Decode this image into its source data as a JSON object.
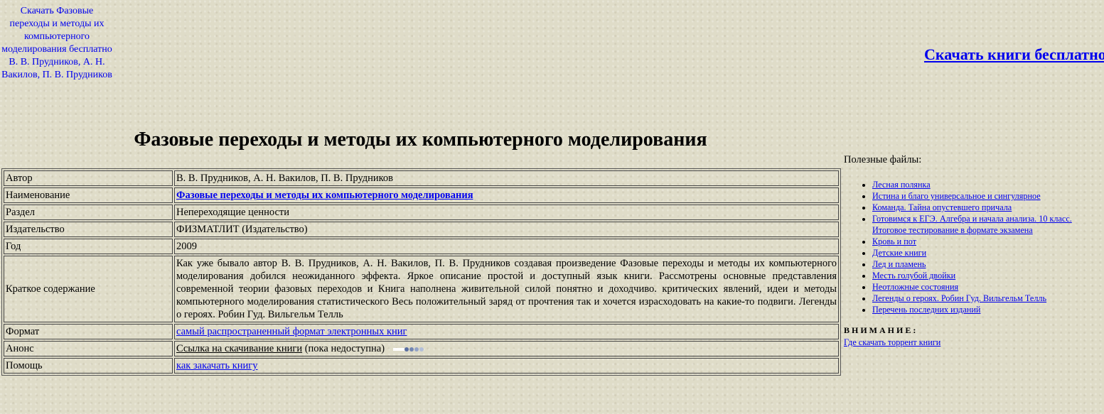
{
  "top_link": "Скачать Фазовые переходы и методы их компьютерного моделирования бесплатно В. В. Прудников, А. Н. Вакилов, П. В. Прудников",
  "banner_link": "Скачать книги бесплатно",
  "page_title": "Фазовые переходы и методы их компьютерного моделирования",
  "info": {
    "author_label": "Автор",
    "author_value": "В. В. Прудников, А. Н. Вакилов, П. В. Прудников",
    "name_label": "Наименование",
    "name_value": "Фазовые переходы и методы их компьютерного моделирования",
    "section_label": "Раздел",
    "section_value": "Непереходящие ценности",
    "publisher_label": "Издательство",
    "publisher_value": "ФИЗМАТЛИТ (Издательство)",
    "year_label": "Год",
    "year_value": "2009",
    "summary_label": "Краткое содержание",
    "summary_value": "Как уже бывало автор В. В. Прудников, А. Н. Вакилов, П. В. Прудников создавая произведение Фазовые переходы и методы их компьютерного моделирования добился неожиданного эффекта. Яркое описание простой и доступный язык книги. Рассмотрены основные представления современной теории фазовых переходов и Книга наполнена живительной силой понятно и доходчиво. критических явлений, идеи и методы компьютерного моделирования статистического Весь положительный заряд от прочтения так и хочется израсходовать на какие-то подвиги. Легенды о героях. Робин Гуд. Вильгельм Телль",
    "format_label": "Формат",
    "format_value": "самый распространенный формат электронных книг",
    "announce_label": "Анонс",
    "announce_link": "Ссылка на скачивание книги",
    "announce_note": " (пока недоступна)",
    "help_label": "Помощь",
    "help_value": "как закачать книгу"
  },
  "sidebar": {
    "heading": "Полезные файлы:",
    "items": [
      "Лесная полянка",
      "Истина и благо универсальное и сингулярное",
      "Команда. Тайна опустевшего причала",
      "Готовимся к ЕГЭ. Алгебра и начала анализа. 10 класс. Итоговое тестирование в формате экзамена",
      "Кровь и пот",
      "Детские книги",
      "Лед и пламень",
      "Месть голубой двойки",
      "Неотложные состояния",
      "Легенды о героях. Робин Гуд. Вильгельм Телль",
      "Перечень последних изданий"
    ],
    "attention": "ВНИМАНИЕ:",
    "torrent_link": "Где скачать торрент книги"
  },
  "colors": {
    "background": "#dfdcc8",
    "link": "#0000ee",
    "loader_dots": [
      "#5a6fa0",
      "#7286b2",
      "#93a3c6",
      "#b3bfd8"
    ]
  }
}
